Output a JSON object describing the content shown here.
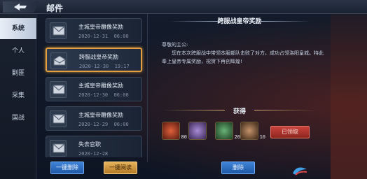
{
  "window": {
    "title": "邮件"
  },
  "tabs": [
    {
      "label": "系统",
      "active": true
    },
    {
      "label": "个人",
      "active": false
    },
    {
      "label": "剿匪",
      "active": false
    },
    {
      "label": "采集",
      "active": false
    },
    {
      "label": "国战",
      "active": false
    }
  ],
  "mails": [
    {
      "title": "主城皇帝雕像奖励",
      "date": "2020-12-31",
      "time": "06:00",
      "selected": false
    },
    {
      "title": "跨服战皇帝奖励",
      "date": "2020-12-30",
      "time": "19:17",
      "selected": true
    },
    {
      "title": "主城皇帝雕像奖励",
      "date": "2020-12-30",
      "time": "06:00",
      "selected": false
    },
    {
      "title": "主城皇帝雕像奖励",
      "date": "2020-12-29",
      "time": "06:00",
      "selected": false
    },
    {
      "title": "失去官职",
      "date": "2020-12-28",
      "time": "",
      "selected": false
    }
  ],
  "detail": {
    "title": "跨服战皇帝奖励",
    "greeting": "尊敬的主公:",
    "message": "您在本次跨服战中带领本服部队击败了对方，成功占领洛阳皇城。特此奉上皇帝专属奖励，祝贺下再创辉煌!",
    "obtain_label": "获得",
    "rewards": [
      {
        "icon": "fire-orb-icon",
        "count": "80",
        "color": "#d04a2c"
      },
      {
        "icon": "treasure-chest-icon",
        "count": "",
        "color": "#7a5aa8"
      },
      {
        "icon": "scroll-icon",
        "count": "20",
        "color": "#3f8a4a"
      },
      {
        "icon": "general-portrait-icon",
        "count": "10",
        "color": "#9a6a40"
      }
    ],
    "claimed_label": "已领取"
  },
  "toolbar": {
    "delete_all_label": "一键删除",
    "read_all_label": "一键阅读",
    "delete_label": "删除"
  }
}
